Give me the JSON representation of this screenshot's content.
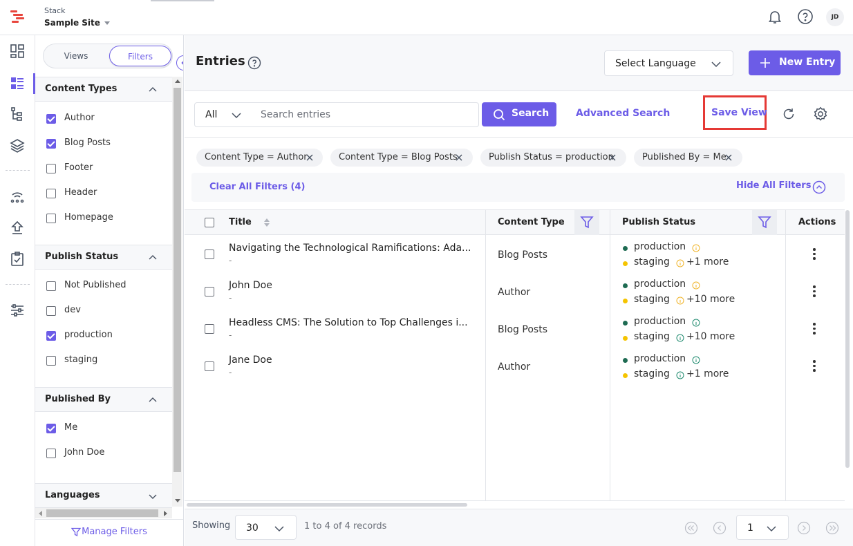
{
  "header": {
    "org_label": "Stack",
    "site_name": "Sample Site",
    "avatar_initials": "JD"
  },
  "sidebar": {
    "tabs": [
      "Views",
      "Filters"
    ],
    "active_tab": "Filters",
    "sections": [
      {
        "title": "Content Types",
        "items": [
          {
            "label": "Author",
            "checked": true
          },
          {
            "label": "Blog Posts",
            "checked": true
          },
          {
            "label": "Footer",
            "checked": false
          },
          {
            "label": "Header",
            "checked": false
          },
          {
            "label": "Homepage",
            "checked": false
          }
        ]
      },
      {
        "title": "Publish Status",
        "items": [
          {
            "label": "Not Published",
            "checked": false
          },
          {
            "label": "dev",
            "checked": false
          },
          {
            "label": "production",
            "checked": true
          },
          {
            "label": "staging",
            "checked": false
          }
        ]
      },
      {
        "title": "Published By",
        "items": [
          {
            "label": "Me",
            "checked": true
          },
          {
            "label": "John Doe",
            "checked": false
          }
        ]
      },
      {
        "title": "Languages",
        "items": []
      }
    ],
    "manage_filters_label": "Manage Filters"
  },
  "page": {
    "title": "Entries",
    "language_placeholder": "Select Language",
    "new_entry_label": "New Entry"
  },
  "search": {
    "scope": "All",
    "placeholder": "Search entries",
    "search_label": "Search",
    "advanced_label": "Advanced Search",
    "save_view_label": "Save View"
  },
  "filters": {
    "chips": [
      "Content Type = Author",
      "Content Type = Blog Posts",
      "Publish Status = production",
      "Published By = Me"
    ],
    "clear_label": "Clear All Filters (4)",
    "hide_label": "Hide All Filters"
  },
  "table": {
    "columns": [
      "Title",
      "Content Type",
      "Publish Status",
      "Actions"
    ],
    "rows": [
      {
        "title": "Navigating the Technological Ramifications: Ada...",
        "sub": "-",
        "content_type": "Blog Posts",
        "status1": "production",
        "status2": "staging",
        "more": "+1 more",
        "info_color": "#f0b429"
      },
      {
        "title": "John Doe",
        "sub": "-",
        "content_type": "Author",
        "status1": "production",
        "status2": "staging",
        "more": "+10 more",
        "info_color": "#f0b429"
      },
      {
        "title": "Headless CMS: The Solution to Top Challenges i...",
        "sub": "-",
        "content_type": "Blog Posts",
        "status1": "production",
        "status2": "staging",
        "more": "+10 more",
        "info_color": "#1e8a6e"
      },
      {
        "title": "Jane Doe",
        "sub": "-",
        "content_type": "Author",
        "status1": "production",
        "status2": "staging",
        "more": "+1 more",
        "info_color": "#1e8a6e"
      }
    ]
  },
  "footer": {
    "showing_label": "Showing",
    "page_size": "30",
    "records_text": "1 to 4 of 4 records",
    "current_page": "1"
  },
  "colors": {
    "accent": "#6c5ce7",
    "production_dot": "#1e6b52",
    "staging_dot": "#f5c400",
    "highlight_box": "#e53935"
  }
}
